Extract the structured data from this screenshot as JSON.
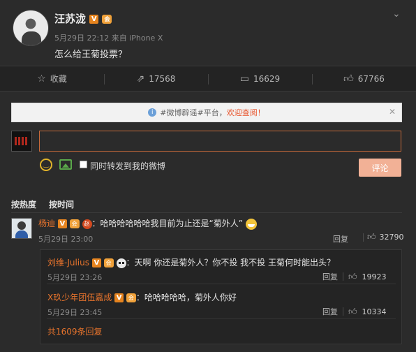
{
  "post": {
    "username": "汪苏泷",
    "verified_badge": "V",
    "vip_badge": "会",
    "timestamp": "5月29日 22:12",
    "source": "来自 iPhone X",
    "text": "怎么给王菊投票？"
  },
  "actions": [
    {
      "icon": "star-icon",
      "label": "收藏"
    },
    {
      "icon": "share-icon",
      "label": "17568"
    },
    {
      "icon": "comment-icon",
      "label": "16629"
    },
    {
      "icon": "thumbs-up-icon",
      "label": "67766"
    }
  ],
  "notice": {
    "prefix": "#微博辟谣#平台，",
    "link": "欢迎查阅！"
  },
  "composer": {
    "input_value": "",
    "repost_label": "同时转发到我的微博",
    "submit_label": "评论"
  },
  "sort_tabs": [
    "按热度",
    "按时间"
  ],
  "comment": {
    "username": "杨迪",
    "badge_text": "赵",
    "text": "：哈哈哈哈哈哈我目前为止还是“菊外人”",
    "time": "5月29日 23:00",
    "reply_label": "回复",
    "likes": "32790"
  },
  "replies": [
    {
      "username": "刘维-Julius",
      "text": "：天啊 你还是菊外人？你不投 我不投 王菊何时能出头？",
      "time": "5月29日 23:26",
      "reply_label": "回复",
      "likes": "19923"
    },
    {
      "username": "X玖少年团伍嘉成",
      "text": "：哈哈哈哈哈，菊外人你好",
      "time": "5月29日 23:45",
      "reply_label": "回复",
      "likes": "10334"
    }
  ],
  "more_replies": "共1609条回复",
  "colors": {
    "background": "#2b2b2b",
    "accent_orange": "#e8742c",
    "submit_button": "#f2b196",
    "verified": "#e6841f"
  }
}
